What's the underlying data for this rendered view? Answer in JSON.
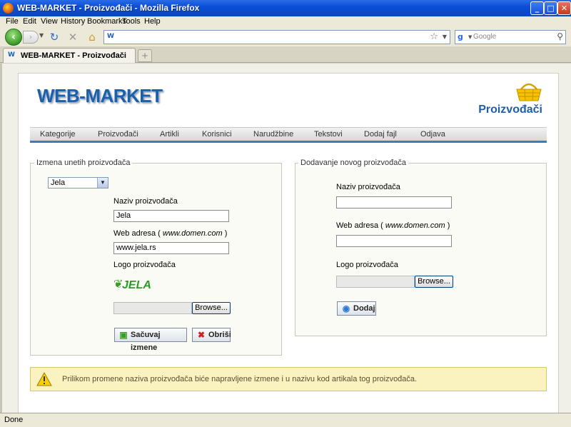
{
  "window": {
    "title": "WEB-MARKET - Proizvođači - Mozilla Firefox"
  },
  "menu": [
    "File",
    "Edit",
    "View",
    "History",
    "Bookmarks",
    "Tools",
    "Help"
  ],
  "search": {
    "placeholder": "Google"
  },
  "tab": {
    "label": "WEB-MARKET - Proizvođači",
    "new_tab": "+"
  },
  "site": {
    "logo": "WEB-MARKET",
    "page_heading": "Proizvođači",
    "nav": [
      "Kategorije",
      "Proizvođači",
      "Artikli",
      "Korisnici",
      "Narudžbine",
      "Tekstovi",
      "Dodaj fajl",
      "Odjava"
    ]
  },
  "edit_form": {
    "legend": "Izmena unetih proizvođača",
    "selected_manufacturer": "Jela",
    "name_label": "Naziv proizvođača",
    "name_value": "Jela",
    "web_label_prefix": "Web adresa ( ",
    "web_label_example": "www.domen.com",
    "web_label_suffix": " )",
    "web_value": "www.jela.rs",
    "logo_label": "Logo proizvođača",
    "logo_text": "JELA",
    "browse_label": "Browse...",
    "save_label": "Sačuvaj izmene",
    "delete_label": "Obriši"
  },
  "add_form": {
    "legend": "Dodavanje novog proizvođača",
    "name_label": "Naziv proizvođača",
    "name_value": "",
    "web_label_prefix": "Web adresa ( ",
    "web_label_example": "www.domen.com",
    "web_label_suffix": " )",
    "web_value": "",
    "logo_label": "Logo proizvođača",
    "browse_label": "Browse...",
    "add_label": "Dodaj"
  },
  "notice": {
    "message": "Prilikom promene naziva proizvođača biće napravljene izmene i u nazivu kod artikala tog proizvođača."
  },
  "status": {
    "text": "Done"
  },
  "colors": {
    "brand_blue": "#1e5fa8",
    "nav_underline": "#3c7bc2",
    "notice_bg": "#faf3c0",
    "titlebar": "#0a4fd6"
  }
}
